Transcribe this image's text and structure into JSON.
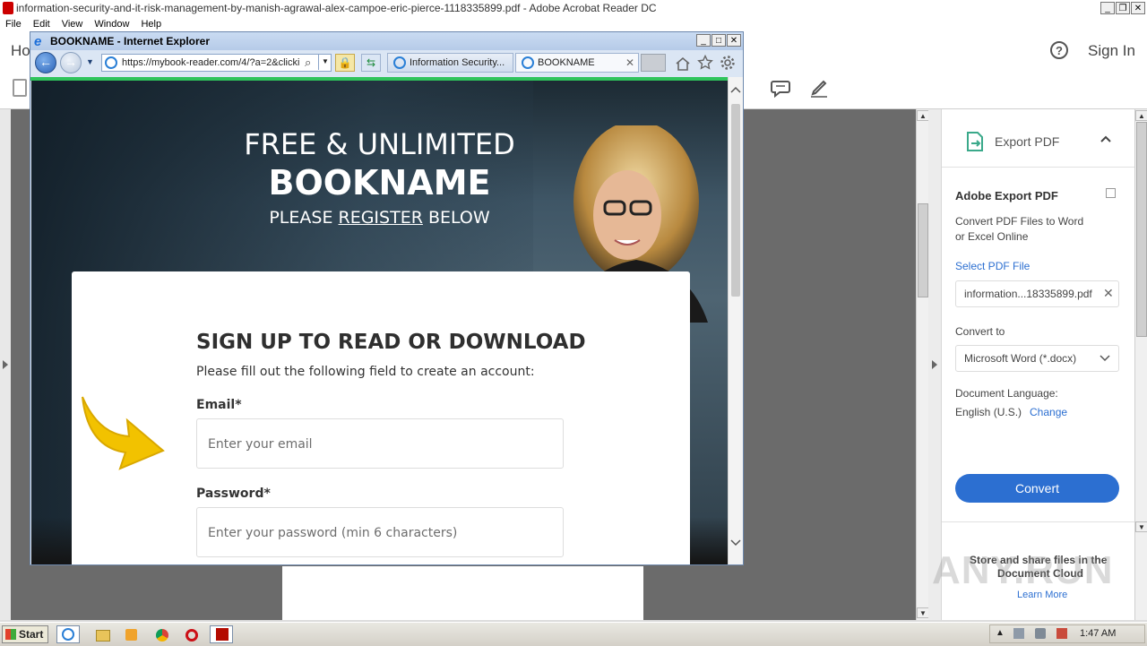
{
  "acrobat": {
    "window_title": "information-security-and-it-risk-management-by-manish-agrawal-alex-campoe-eric-pierce-1118335899.pdf - Adobe Acrobat Reader DC",
    "menu": [
      "File",
      "Edit",
      "View",
      "Window",
      "Help"
    ],
    "home_tab": "Ho",
    "help_icon": "?",
    "sign_in": "Sign In"
  },
  "right_panel": {
    "section_title": "Export PDF",
    "heading": "Adobe Export PDF",
    "description_line1": "Convert PDF Files to Word",
    "description_line2": "or Excel Online",
    "select_file_label": "Select PDF File",
    "file_value": "information...18335899.pdf",
    "convert_to_label": "Convert to",
    "convert_to_value": "Microsoft Word (*.docx)",
    "doc_language_label": "Document Language:",
    "doc_language_value": "English (U.S.)",
    "change_link": "Change",
    "convert_button": "Convert",
    "cloud_text_line1": "Store and share files in the",
    "cloud_text_line2": "Document Cloud",
    "learn_more": "Learn More"
  },
  "ie": {
    "window_title": "BOOKNAME - Internet Explorer",
    "address": "https://mybook-reader.com/4/?a=2&clicki",
    "tabs": [
      {
        "label": "Information Security..."
      },
      {
        "label": "BOOKNAME"
      }
    ]
  },
  "page": {
    "hero_line1": "FREE & UNLIMITED",
    "hero_line2": "BOOKNAME",
    "hero_line3_before": "PLEASE ",
    "hero_line3_link": "REGISTER",
    "hero_line3_after": " BELOW",
    "signup_title": "SIGN UP TO READ OR DOWNLOAD",
    "signup_subtitle": "Please fill out the following field to create an account:",
    "email_label": "Email*",
    "email_placeholder": "Enter your email",
    "password_label": "Password*",
    "password_placeholder": "Enter your password (min 6 characters)"
  },
  "taskbar": {
    "start": "Start",
    "clock": "1:47 AM"
  },
  "watermark": "ANY.RUN",
  "colors": {
    "acrobat_accent": "#2c6fd1",
    "ie_progress_green": "#2fc45c",
    "arrow_yellow": "#f2c200"
  }
}
